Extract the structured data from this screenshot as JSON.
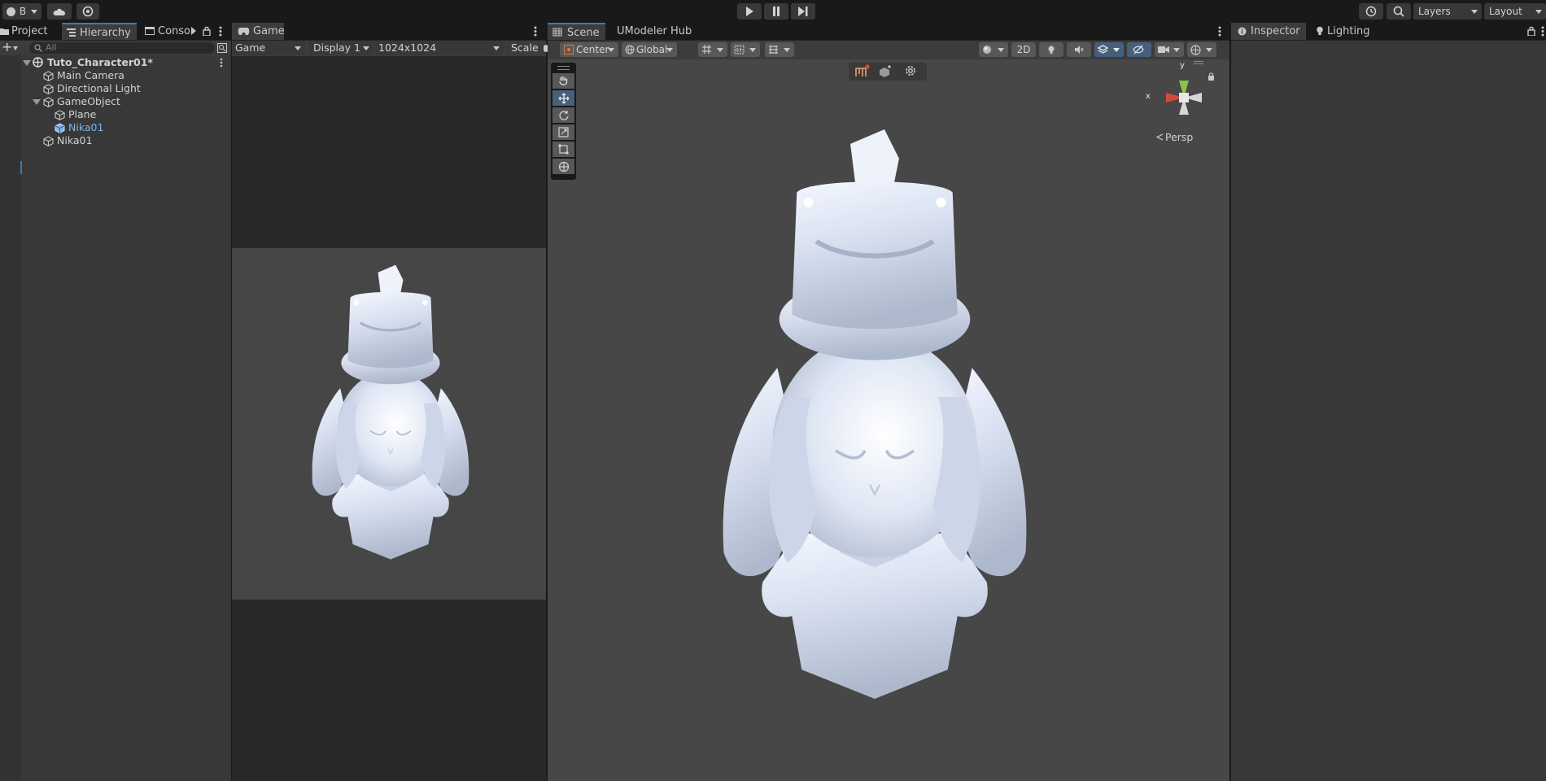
{
  "toolbar": {
    "account_label": "B",
    "layers_label": "Layers",
    "layout_label": "Layout"
  },
  "left_tabs": {
    "project": "Project",
    "hierarchy": "Hierarchy",
    "console": "Conso"
  },
  "hierarchy": {
    "search_placeholder": "All",
    "scene_name": "Tuto_Character01*",
    "items": [
      {
        "label": "Main Camera",
        "depth": 1
      },
      {
        "label": "Directional Light",
        "depth": 1
      },
      {
        "label": "GameObject",
        "depth": 1
      },
      {
        "label": "Plane",
        "depth": 2
      },
      {
        "label": "Nika01",
        "depth": 2,
        "selected": true
      },
      {
        "label": "Nika01",
        "depth": 1
      }
    ]
  },
  "game": {
    "tab": "Game",
    "mode": "Game",
    "display": "Display 1",
    "resolution": "1024x1024",
    "scale_label": "Scale"
  },
  "scene": {
    "tab": "Scene",
    "tab2": "UModeler Hub",
    "pivot": "Center",
    "space": "Global",
    "btn_2d": "2D",
    "persp_label": "Persp",
    "gizmo_x": "x",
    "gizmo_y": "y"
  },
  "right_tabs": {
    "inspector": "Inspector",
    "lighting": "Lighting"
  },
  "colors": {
    "selected_text": "#7fb2ee",
    "active_tool": "#46607c",
    "gizmo_x": "#d24a3e",
    "gizmo_y": "#8ac34a"
  }
}
